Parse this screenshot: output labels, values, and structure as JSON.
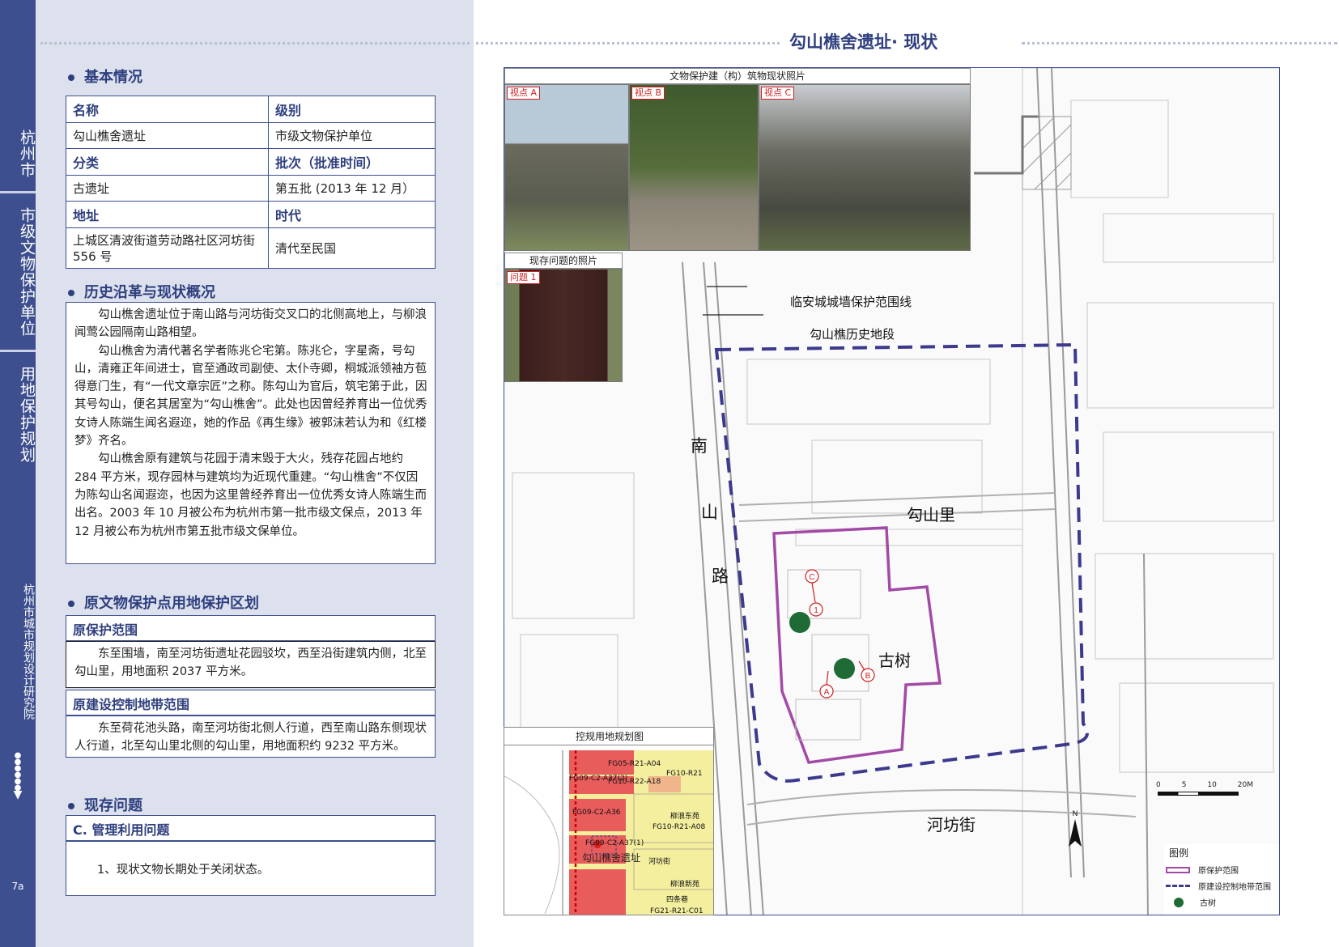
{
  "sidebar": {
    "city": "杭州市",
    "unit_type": "市级文物保护单位",
    "chapter": "用地保护规划",
    "organization": "杭州市城市规划设计研究院",
    "page_number": "7a"
  },
  "sections": {
    "basic_info": "基本情况",
    "history": "历史沿革与现状概况",
    "protection": "原文物保护点用地保护区划",
    "issues": "现存问题"
  },
  "info_table": {
    "name_label": "名称",
    "level_label": "级别",
    "name_value": "勾山樵舍遗址",
    "level_value": "市级文物保护单位",
    "category_label": "分类",
    "batch_label": "批次（批准时间）",
    "category_value": "古遗址",
    "batch_value": "第五批 (2013 年 12 月）",
    "address_label": "地址",
    "era_label": "时代",
    "address_value": "上城区清波街道劳动路社区河坊街 556 号",
    "era_value": "清代至民国"
  },
  "history_text": [
    "勾山樵舍遗址位于南山路与河坊街交叉口的北侧高地上，与柳浪闻莺公园隔南山路相望。",
    "勾山樵舍为清代著名学者陈兆仑宅第。陈兆仑，字星斋，号勾山，清雍正年间进士，官至通政司副使、太仆寺卿，桐城派领袖方苞得意门生，有“一代文章宗匠”之称。陈勾山为官后，筑宅第于此，因其号勾山，便名其居室为“勾山樵舍”。此处也因曾经养育出一位优秀女诗人陈端生闻名遐迩，她的作品《再生缘》被郭沫若认为和《红楼梦》齐名。",
    "勾山樵舍原有建筑与花园于清末毁于大火，残存花园占地约 284 平方米，现存园林与建筑均为近现代重建。“勾山樵舍”不仅因为陈勾山名闻遐迩，也因为这里曾经养育出一位优秀女诗人陈端生而出名。2003 年 10 月被公布为杭州市第一批市级文保点，2013 年 12 月被公布为杭州市第五批市级文保单位。"
  ],
  "protection": {
    "range_label": "原保护范围",
    "range_text": "东至围墙，南至河坊街遗址花园驳坎，西至沿街建筑内侧，北至勾山里，用地面积 2037 平方米。",
    "control_label": "原建设控制地带范围",
    "control_text": "东至荷花池头路，南至河坊街北侧人行道，西至南山路东侧现状人行道，北至勾山里北侧的勾山里，用地面积约 9232 平方米。"
  },
  "issues": {
    "category_label": "C. 管理利用问题",
    "items": [
      "1、现状文物长期处于关闭状态。"
    ]
  },
  "map": {
    "page_title": "勾山樵舍遗址· 现状",
    "photo_panel_title": "文物保护建（构）筑物现状照片",
    "photo_tags": [
      "视点 A",
      "视点 B",
      "视点 C"
    ],
    "problem_panel_title": "现存问题的照片",
    "problem_tag": "问题 1",
    "callout_wall": "临安城城墙保护范围线",
    "callout_district": "勾山樵历史地段",
    "road_nanshan": [
      "南",
      "山",
      "路"
    ],
    "road_goushanli": "勾山里",
    "road_hefang": "河坊街",
    "tree_label": "古树",
    "markers": [
      "C",
      "1",
      "A",
      "B"
    ],
    "north": "N",
    "scale_ticks": [
      "0",
      "5",
      "10",
      "20M"
    ],
    "legend": {
      "title": "图例",
      "items": [
        "原保护范围",
        "原建设控制地带范围",
        "古树"
      ]
    },
    "colors": {
      "protection": "#a24aa6",
      "control": "#3d3a8e",
      "tree": "#1f6b35"
    }
  },
  "inset": {
    "title": "控规用地规划图",
    "labels": [
      "FG05-R21-A04",
      "FG09-C2-A37(2)",
      "FG10-R22-A18",
      "FG10-R21",
      "FG09-C2-A36",
      "FG10-R21-A08",
      "FG09-C2-A37(1)",
      "河坊街",
      "柳浪东苑",
      "柳浪新苑",
      "四条巷",
      "FG21-R21-C01"
    ],
    "site_label": "勾山樵舍遗址"
  }
}
